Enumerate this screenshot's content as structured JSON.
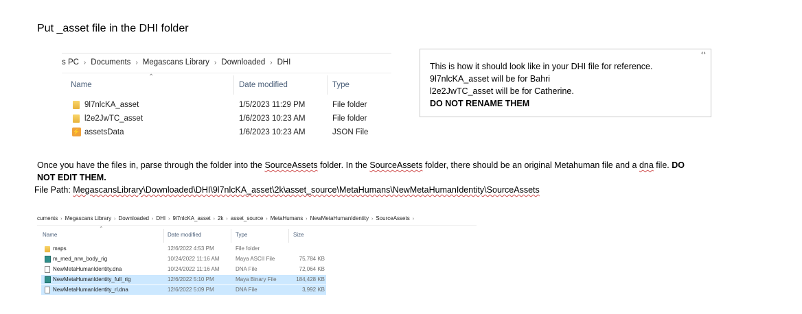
{
  "heading": "Put _asset file in the DHI folder",
  "explorer1": {
    "breadcrumb": [
      "s PC",
      "Documents",
      "Megascans Library",
      "Downloaded",
      "DHI"
    ],
    "columns": {
      "name": "Name",
      "date": "Date modified",
      "type": "Type"
    },
    "rows": [
      {
        "icon": "folder-icon",
        "name": "9l7nlcKA_asset",
        "date": "1/5/2023 11:29 PM",
        "type": "File folder"
      },
      {
        "icon": "folder-icon",
        "name": "l2e2JwTC_asset",
        "date": "1/6/2023 10:23 AM",
        "type": "File folder"
      },
      {
        "icon": "json-file-icon",
        "name": "assetsData",
        "date": "1/6/2023 10:23 AM",
        "type": "JSON File"
      }
    ]
  },
  "note": {
    "lines": [
      "This is how it should look like in your DHI file for reference.",
      "9l7nlcKA_asset will be for Bahri",
      "l2e2JwTC_asset will be for Catherine."
    ],
    "bold_line": "DO NOT RENAME THEM"
  },
  "paragraph": {
    "part1": " Once you have the files in, parse through the folder into the ",
    "w1": "SourceAssets",
    "part2": " folder. In the ",
    "w2": "SourceAssets",
    "part3": " folder, there should be an original Metahuman file and a ",
    "w3": "dna",
    "part4": " file. ",
    "bold": "DO NOT EDIT THEM.",
    "path_label": "File Path:  ",
    "path": "MegascansLibrary\\Downloaded\\DHI\\9l7nlcKA_asset\\2k\\asset_source\\MetaHumans\\NewMetaHumanIdentity\\SourceAssets"
  },
  "explorer2": {
    "breadcrumb": [
      "cuments",
      "Megascans Library",
      "Downloaded",
      "DHI",
      "9l7nlcKA_asset",
      "2k",
      "asset_source",
      "MetaHumans",
      "NewMetaHumanIdentity",
      "SourceAssets"
    ],
    "columns": {
      "name": "Name",
      "date": "Date modified",
      "type": "Type",
      "size": "Size"
    },
    "rows": [
      {
        "icon": "folder-icon",
        "name": "maps",
        "date": "12/6/2022 4:53 PM",
        "type": "File folder",
        "size": "",
        "selected": false
      },
      {
        "icon": "maya-file-icon",
        "name": "m_med_nrw_body_rig",
        "date": "10/24/2022 11:16 AM",
        "type": "Maya ASCII File",
        "size": "75,784 KB",
        "selected": false
      },
      {
        "icon": "file-icon",
        "name": "NewMetaHumanIdentity.dna",
        "date": "10/24/2022 11:16 AM",
        "type": "DNA File",
        "size": "72,064 KB",
        "selected": false
      },
      {
        "icon": "maya-file-icon",
        "name": "NewMetaHumanIdentity_full_rig",
        "date": "12/6/2022 5:10 PM",
        "type": "Maya Binary File",
        "size": "184,428 KB",
        "selected": true
      },
      {
        "icon": "file-icon",
        "name": "NewMetaHumanIdentity_rl.dna",
        "date": "12/6/2022 5:09 PM",
        "type": "DNA File",
        "size": "3,992 KB",
        "selected": true
      }
    ]
  }
}
